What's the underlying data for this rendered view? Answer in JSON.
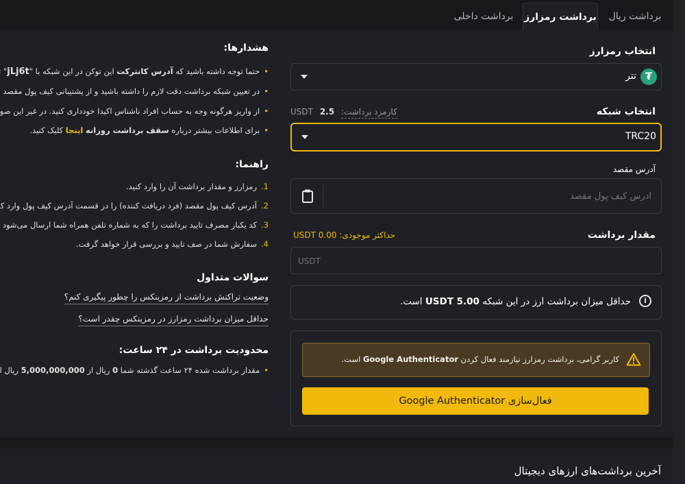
{
  "tabs": [
    {
      "label": "برداشت ریال"
    },
    {
      "label": "برداشت رمزارز"
    },
    {
      "label": "برداشت داخلی"
    }
  ],
  "form": {
    "currency_label": "انتخاب رمزارز",
    "currency_value": "تتر",
    "currency_icon_glyph": "₮",
    "currency_icon_color": "#26a17b",
    "network_label": "انتخاب شبکه",
    "fee_label": "کارمزد برداشت:",
    "fee_value": "2.5",
    "fee_unit": "USDT",
    "network_value": "TRC20",
    "address_label": "آدرس مقصد",
    "address_placeholder": "آدرس کیف پول مقصد",
    "amount_label": "مقدار برداشت",
    "max_available": "حداکثر موجودی: USDT 0.00",
    "amount_placeholder": "USDT",
    "min_info": {
      "pre": "حداقل میزان برداشت ارز در این شبکه ",
      "bold": "USDT 5.00",
      "post": " است."
    },
    "warning": {
      "pre": "کاربر گرامی، برداشت رمزارز نیازمند فعال کردن ",
      "bold": "Google Authenticator",
      "post": " است."
    },
    "activate_button": "فعال‌سازی Google Authenticator"
  },
  "notices": {
    "title": "هشدارها:",
    "items": [
      {
        "pre": "حتما توجه داشته باشید که ",
        "bold": "آدرس کانترکت",
        "post": " این توکن در این شبکه با \"",
        "code": "jLj6t",
        "tail": "\" تمام"
      },
      {
        "text": "در تعیین شبکه برداشت دقت لازم را داشته باشید و از پشتیبانی کیف پول مقصد اط"
      },
      {
        "text": "از واریز هرگونه وجه به حساب افراد ناشناس اکیدا خودداری کنید. در غیر این صورت"
      },
      {
        "pre": "برای اطلاعات بیشتر درباره ",
        "bold": "سقف برداشت روزانه",
        "link": "اینجا",
        "post": " کلیک کنید."
      }
    ]
  },
  "guide": {
    "title": "راهنما:",
    "steps": [
      {
        "num": "1.",
        "text": "رمزارز و مقدار برداشت آن را وارد کنید."
      },
      {
        "num": "2.",
        "text": "آدرس کیف پول مقصد (فرد دریافت کننده) را در قسمت آدرس کیف پول وارد کنید."
      },
      {
        "num": "3.",
        "text": "کد یکبار مصرف تایید برداشت را که به شماره تلفن همراه شما ارسال می‌شود وارد کنید."
      },
      {
        "num": "4.",
        "text": "سفارش شما در صف تایید و بررسی قرار خواهد گرفت."
      }
    ]
  },
  "faq": {
    "title": "سوالات متداول",
    "items": [
      {
        "text": "وضعیت تراکنش برداشت از رمزینکس را چطور پیگیری کنم؟"
      },
      {
        "text": "حداقل میزان برداشت رمزارز در رمزینکس چقدر است؟"
      }
    ]
  },
  "limits": {
    "title": "محدودیت برداشت در ۲۴ ساعت:",
    "pre": "مقدار برداشت شده ۲۴ ساعت گذشته شما ",
    "bold1": "0",
    "mid": " ریال از ",
    "bold2": "5,000,000,000",
    "post": " ریال است."
  },
  "recent": {
    "title": "آخرین برداشت‌های ارزهای دیجیتال"
  },
  "colors": {
    "accent": "#f0b90b",
    "background": "#17181c",
    "panel": "#1f2025",
    "warning_bg": "#4a3a23"
  }
}
